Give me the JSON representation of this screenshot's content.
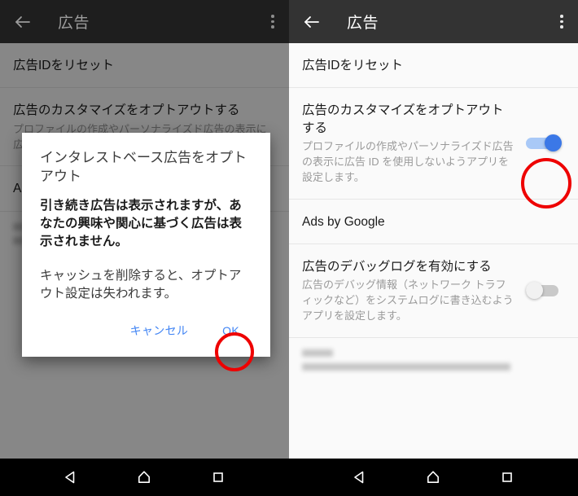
{
  "app": {
    "title": "広告",
    "back_icon": "arrow-left-icon",
    "overflow_icon": "more-vert-icon"
  },
  "left_phone": {
    "appbar_title": "広告",
    "rows": [
      {
        "title": "広告IDをリセット"
      },
      {
        "title": "広告のカスタマイズをオプトアウトする",
        "sub": "プロファイルの作成やパーソナライズド広告の表示に広告 ID を使用しないようアプリを設定します。"
      },
      {
        "title": "Ads by Google"
      }
    ],
    "dialog": {
      "title": "インタレストベース広告をオプトアウト",
      "body_strong": "引き続き広告は表示されますが、あなたの興味や関心に基づく広告は表示されません。",
      "body": "キャッシュを削除すると、オプトアウト設定は失われます。",
      "cancel_label": "キャンセル",
      "ok_label": "OK"
    }
  },
  "right_phone": {
    "appbar_title": "広告",
    "rows": [
      {
        "title": "広告IDをリセット"
      },
      {
        "title": "広告のカスタマイズをオプトアウトする",
        "sub": "プロファイルの作成やパーソナライズド広告の表示に広告 ID を使用しないようアプリを設定します。",
        "toggle": "on"
      },
      {
        "title": "Ads by Google"
      },
      {
        "title": "広告のデバッグログを有効にする",
        "sub": "広告のデバッグ情報（ネットワーク トラフィックなど）をシステムログに書き込むようアプリを設定します。",
        "toggle": "off"
      }
    ]
  },
  "navbar": {
    "back_icon": "nav-back-triangle-icon",
    "home_icon": "nav-home-icon",
    "recents_icon": "nav-recents-square-icon"
  },
  "annotations": {
    "circle_color": "#ee0000",
    "targets": [
      "ok-button",
      "opt-out-toggle"
    ]
  },
  "colors": {
    "appbar": "#333333",
    "toggle_on": "#3b78e7",
    "link": "#4285f4",
    "surface": "#fafafa",
    "navbar": "#000000"
  }
}
